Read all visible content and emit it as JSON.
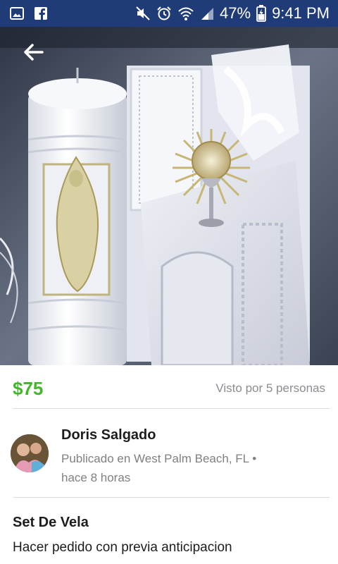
{
  "status_bar": {
    "battery": "47%",
    "time": "9:41 PM",
    "icons": [
      "gallery-icon",
      "facebook-icon",
      "mute-icon",
      "alarm-icon",
      "wifi-icon",
      "signal-icon",
      "battery-icon"
    ]
  },
  "listing": {
    "price": "$75",
    "views": "Visto por 5 personas",
    "seller_name": "Doris Salgado",
    "posted_location": "Publicado en West Palm Beach, FL",
    "posted_time": "hace 8 horas",
    "title": "Set De Vela",
    "description": "Hacer pedido con previa anticipacion"
  },
  "colors": {
    "status_bar": "#1f3b78",
    "price": "#42b72a",
    "muted_text": "#808080"
  }
}
